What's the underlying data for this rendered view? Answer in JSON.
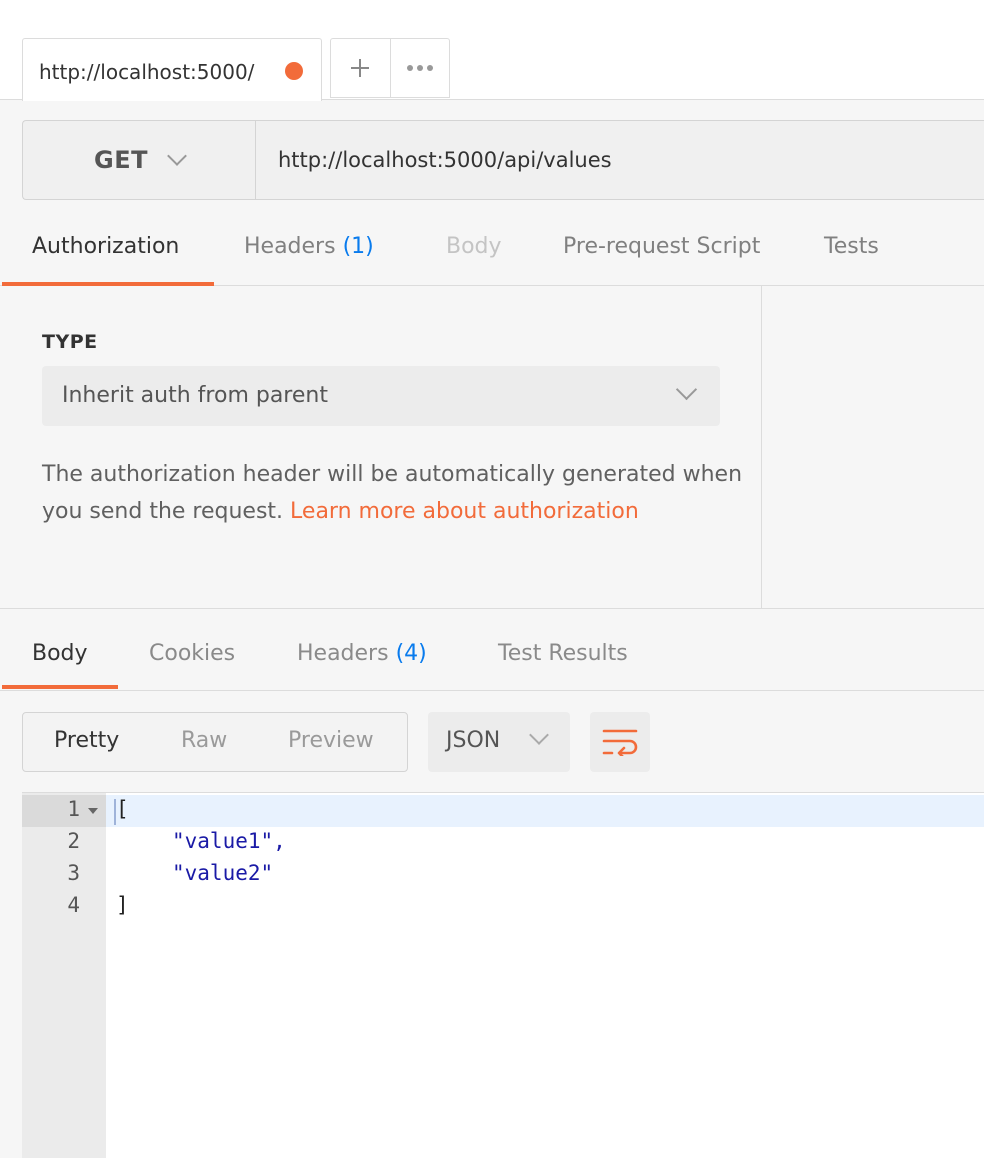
{
  "request_tab": {
    "title": "http://localhost:5000/",
    "unsaved": true
  },
  "tab_actions": {
    "new_tab_icon": "plus-icon",
    "more_icon": "ellipsis-icon"
  },
  "request": {
    "method": "GET",
    "url": "http://localhost:5000/api/values"
  },
  "request_tabs": [
    {
      "label": "Authorization",
      "count": "",
      "state": "active"
    },
    {
      "label": "Headers",
      "count": "(1)",
      "state": "normal"
    },
    {
      "label": "Body",
      "count": "",
      "state": "disabled"
    },
    {
      "label": "Pre-request Script",
      "count": "",
      "state": "normal"
    },
    {
      "label": "Tests",
      "count": "",
      "state": "normal"
    }
  ],
  "auth": {
    "type_label": "TYPE",
    "type_value": "Inherit auth from parent",
    "description": "The authorization header will be automatically generated when you send the request.",
    "link_text": "Learn more about authorization"
  },
  "response_tabs": [
    {
      "label": "Body",
      "count": "",
      "state": "active"
    },
    {
      "label": "Cookies",
      "count": "",
      "state": "normal"
    },
    {
      "label": "Headers",
      "count": "(4)",
      "state": "normal"
    },
    {
      "label": "Test Results",
      "count": "",
      "state": "normal"
    }
  ],
  "response_view": {
    "modes": [
      "Pretty",
      "Raw",
      "Preview"
    ],
    "active_mode": "Pretty",
    "format": "JSON",
    "wrap_icon": "wrap-lines-icon"
  },
  "response_body": {
    "lines": [
      {
        "num": "1",
        "text": "["
      },
      {
        "num": "2",
        "text": "\"value1\","
      },
      {
        "num": "3",
        "text": "\"value2\""
      },
      {
        "num": "4",
        "text": "]"
      }
    ]
  },
  "colors": {
    "accent": "#f26b3a",
    "count": "#097bed",
    "json_string": "#1a1aa6"
  }
}
